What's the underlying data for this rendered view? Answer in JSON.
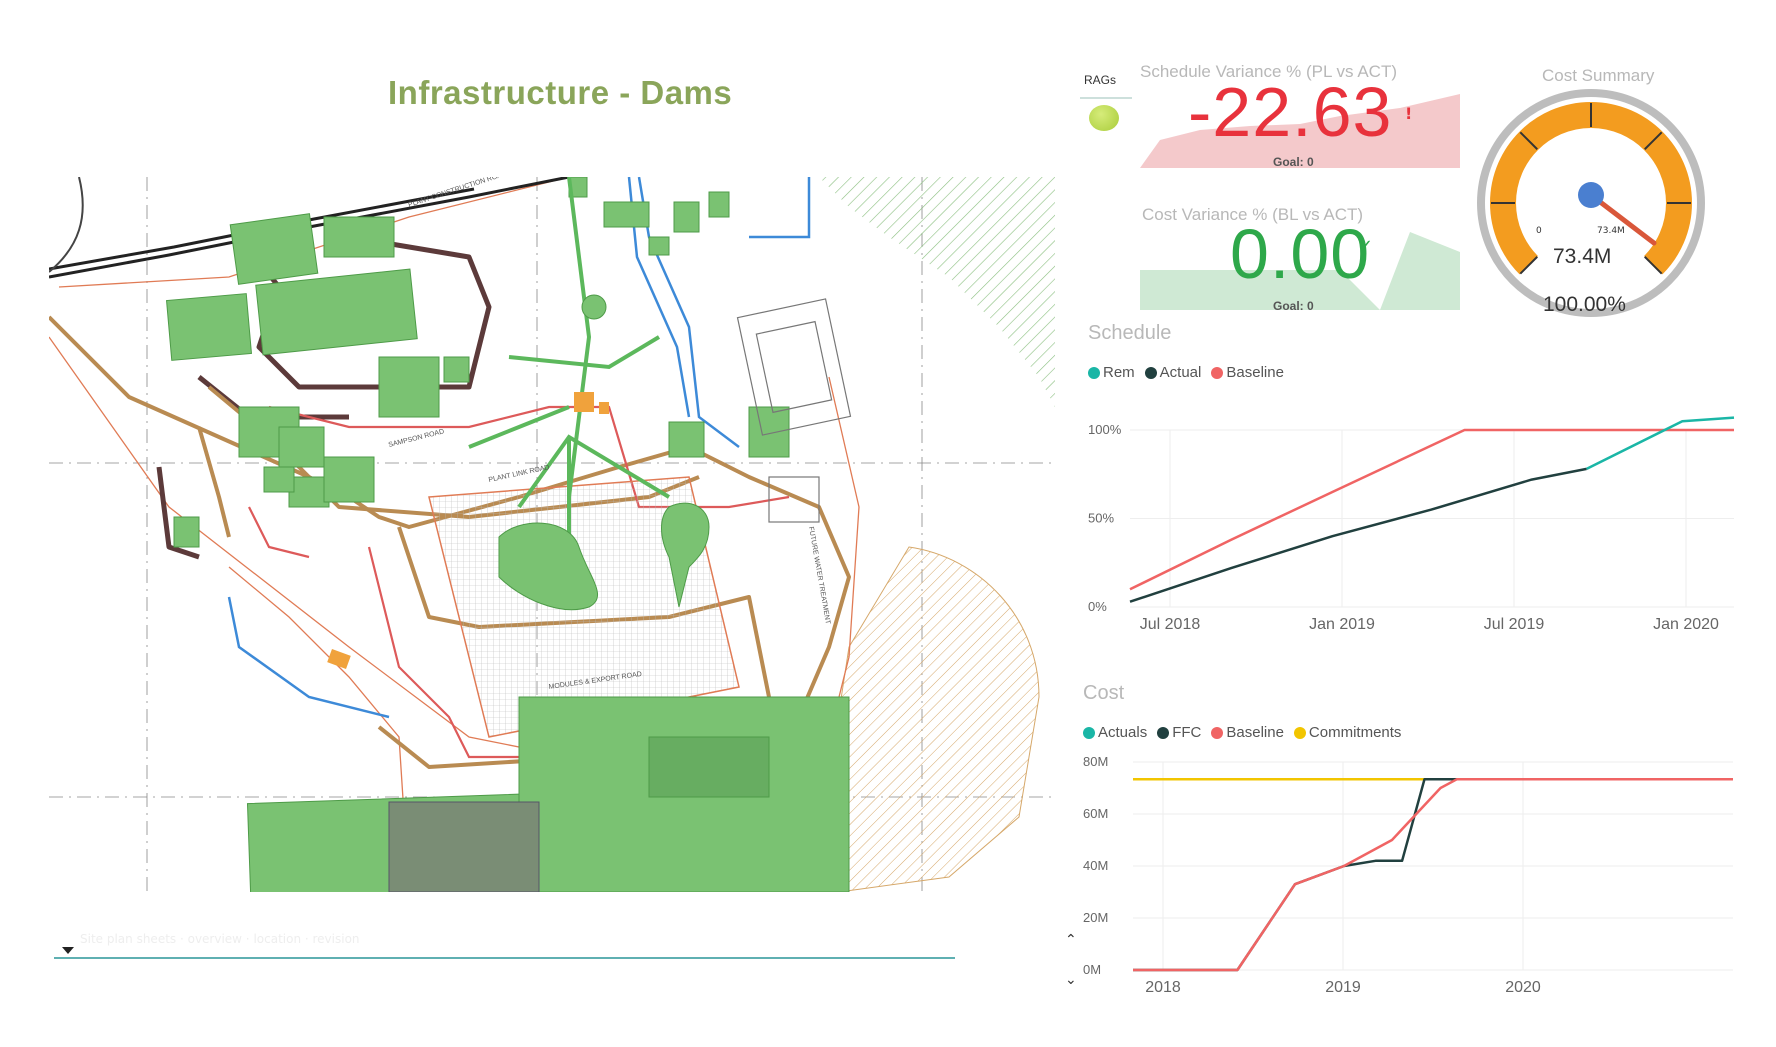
{
  "page": {
    "title": "Infrastructure - Dams"
  },
  "rag": {
    "label": "RAGs",
    "status_color": "#b8d84e"
  },
  "schedule_variance": {
    "title": "Schedule Variance % (PL vs ACT)",
    "value": "-22.63",
    "flag": "!",
    "goal": "Goal: 0",
    "color": "#e8323c"
  },
  "cost_variance": {
    "title": "Cost Variance % (BL vs ACT)",
    "value": "0.00",
    "check": "✓",
    "goal": "Goal: 0",
    "color": "#2ea84a"
  },
  "cost_summary": {
    "title": "Cost Summary",
    "min_label": "0",
    "max_label": "73.4M",
    "value_label": "73.4M",
    "percent_label": "100.00%",
    "fraction": 1.0,
    "arc_color": "#f39c1f",
    "needle_color": "#d9573a",
    "hub_color": "#4a7fd0"
  },
  "schedule": {
    "title": "Schedule",
    "legend": [
      {
        "label": "Rem",
        "color": "#1ab6a6"
      },
      {
        "label": "Actual",
        "color": "#21403f"
      },
      {
        "label": "Baseline",
        "color": "#f06464"
      }
    ]
  },
  "cost": {
    "title": "Cost",
    "legend": [
      {
        "label": "Actuals",
        "color": "#1ab6a6"
      },
      {
        "label": "FFC",
        "color": "#21403f"
      },
      {
        "label": "Baseline",
        "color": "#f06464"
      },
      {
        "label": "Commitments",
        "color": "#f2c500"
      }
    ]
  },
  "slicer": {
    "caption": "Site plan sheets · overview · location · revision"
  },
  "chart_data": [
    {
      "type": "line",
      "title": "Schedule",
      "x_ticks": [
        "Jul 2018",
        "Jan 2019",
        "Jul 2019",
        "Jan 2020"
      ],
      "x_domain": [
        "2018-07-01",
        "2020-01-01"
      ],
      "y_ticks": [
        "0%",
        "50%",
        "100%"
      ],
      "ylim": [
        0,
        100
      ],
      "grid": true,
      "legend_position": "top-left",
      "series": [
        {
          "name": "Baseline",
          "color": "#f06464",
          "points": [
            [
              "2018-07-01",
              10
            ],
            [
              "2018-10-01",
              38
            ],
            [
              "2019-01-01",
              65
            ],
            [
              "2019-05-01",
              100
            ],
            [
              "2020-01-01",
              100
            ]
          ]
        },
        {
          "name": "Actual",
          "color": "#21403f",
          "points": [
            [
              "2018-07-01",
              3
            ],
            [
              "2018-10-01",
              22
            ],
            [
              "2019-01-01",
              40
            ],
            [
              "2019-04-01",
              55
            ],
            [
              "2019-07-01",
              72
            ],
            [
              "2019-08-20",
              78
            ]
          ]
        },
        {
          "name": "Rem",
          "color": "#1ab6a6",
          "points": [
            [
              "2019-08-20",
              78
            ],
            [
              "2019-11-15",
              105
            ],
            [
              "2020-01-01",
              107
            ]
          ]
        }
      ]
    },
    {
      "type": "line",
      "title": "Cost",
      "x_ticks": [
        "2018",
        "2019",
        "2020"
      ],
      "x_domain": [
        "2017-12-01",
        "2020-12-31"
      ],
      "y_ticks": [
        "0M",
        "20M",
        "40M",
        "60M",
        "80M"
      ],
      "ylim": [
        0,
        80
      ],
      "grid": true,
      "legend_position": "top-left",
      "series": [
        {
          "name": "Commitments",
          "color": "#f2c500",
          "points": [
            [
              "2017-12-01",
              73.4
            ],
            [
              "2020-12-31",
              73.4
            ]
          ]
        },
        {
          "name": "FFC",
          "color": "#21403f",
          "points": [
            [
              "2017-12-01",
              0
            ],
            [
              "2018-06-15",
              0
            ],
            [
              "2018-10-01",
              33
            ],
            [
              "2019-01-01",
              40
            ],
            [
              "2019-03-01",
              42
            ],
            [
              "2019-04-20",
              42
            ],
            [
              "2019-06-01",
              73.4
            ],
            [
              "2020-12-31",
              73.4
            ]
          ]
        },
        {
          "name": "Baseline",
          "color": "#f06464",
          "points": [
            [
              "2017-12-01",
              0
            ],
            [
              "2018-06-15",
              0
            ],
            [
              "2018-10-01",
              33
            ],
            [
              "2019-01-01",
              40
            ],
            [
              "2019-04-01",
              50
            ],
            [
              "2019-07-01",
              70
            ],
            [
              "2019-08-01",
              73.4
            ],
            [
              "2020-12-31",
              73.4
            ]
          ]
        }
      ]
    }
  ]
}
